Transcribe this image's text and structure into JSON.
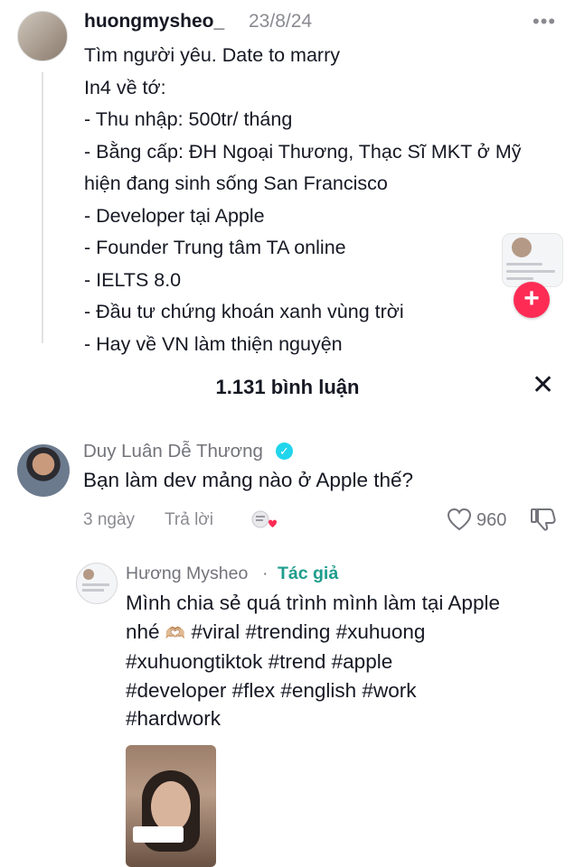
{
  "post": {
    "username": "huongmysheo_",
    "date": "23/8/24",
    "more_icon": "more-horizontal-icon",
    "lines": [
      "Tìm người yêu. Date to marry",
      "In4 về tớ:",
      "- Thu nhập: 500tr/ tháng",
      "- Bằng cấp: ĐH Ngoại Thương, Thạc Sĩ MKT ở Mỹ",
      "hiện đang sinh sống San Francisco",
      "- Developer tại Apple",
      "- Founder Trung tâm TA online",
      "- IELTS 8.0",
      "- Đầu tư chứng khoán xanh vùng trời",
      "-  Hay về VN làm thiện nguyện"
    ]
  },
  "comments_header": {
    "count_label": "1.131 bình luận",
    "close_icon": "close-icon"
  },
  "comment": {
    "author": "Duy Luân Dễ Thương",
    "text": "Bạn làm dev mảng nào ở Apple thế?",
    "time": "3 ngày",
    "reply_label": "Trả lời",
    "like_count": "960"
  },
  "reply": {
    "author": "Hương Mysheo",
    "separator": "·",
    "badge": "Tác giả",
    "lines": [
      " Mình chia sẻ quá trình mình làm tại Apple",
      "nhé",
      " #viral #trending #xuhuong",
      "#xuhuongtiktok #trend #apple",
      "#developer #flex #english #work",
      "#hardwork"
    ],
    "emoji": "🫶🏼"
  },
  "colors": {
    "accent_red": "#fe2c55",
    "verified": "#20d5ec",
    "author_badge": "#1f9d8c",
    "muted_text": "#8a8b91"
  }
}
